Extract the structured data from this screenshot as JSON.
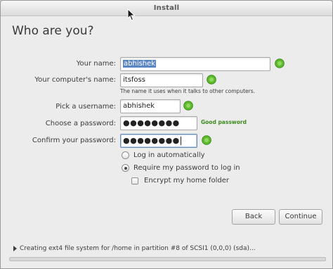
{
  "window": {
    "title": "Install"
  },
  "page": {
    "heading": "Who are you?"
  },
  "form": {
    "name": {
      "label": "Your name:",
      "value": "abhishek"
    },
    "computer_name": {
      "label": "Your computer's name:",
      "value": "itsfoss",
      "hint": "The name it uses when it talks to other computers."
    },
    "username": {
      "label": "Pick a username:",
      "value": "abhishek"
    },
    "password": {
      "label": "Choose a password:",
      "value": "●●●●●●●●",
      "strength": "Good password"
    },
    "confirm_password": {
      "label": "Confirm your password:",
      "value": "●●●●●●●●"
    }
  },
  "login_options": {
    "auto_login": {
      "label": "Log in automatically",
      "selected": false
    },
    "require_password": {
      "label": "Require my password to log in",
      "selected": true
    },
    "encrypt_home": {
      "label": "Encrypt my home folder",
      "checked": false
    }
  },
  "buttons": {
    "back": "Back",
    "continue": "Continue"
  },
  "status": {
    "message": "Creating ext4 file system for /home in partition #8 of SCSI1 (0,0,0) (sda)..."
  },
  "colors": {
    "accent": "#5b86c5",
    "ok": "#5dbb2c",
    "strength": "#3c8a1e"
  },
  "icons": {
    "ok": "green-check-icon",
    "cursor": "mouse-pointer-icon",
    "expander": "expander-arrow-icon"
  }
}
